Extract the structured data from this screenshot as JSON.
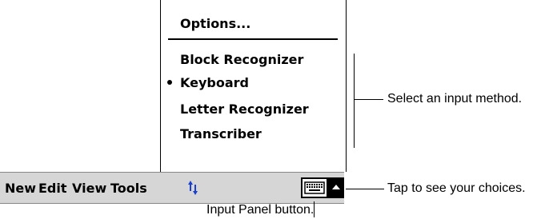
{
  "menu": {
    "options_label": "Options...",
    "items": [
      {
        "label": "Block Recognizer",
        "selected": false
      },
      {
        "label": "Keyboard",
        "selected": true
      },
      {
        "label": "Letter Recognizer",
        "selected": false
      },
      {
        "label": "Transcriber",
        "selected": false
      }
    ]
  },
  "command_bar": {
    "new": "New",
    "edit": "Edit",
    "view": "View",
    "tools": "Tools",
    "sync_icon": "up-down-arrows-icon",
    "input_panel_icon": "keyboard-icon",
    "arrow_icon": "caret-up-icon"
  },
  "annotations": {
    "select_method": "Select an input method.",
    "tap_choices": "Tap to see your choices.",
    "input_panel_button": "Input Panel button."
  }
}
